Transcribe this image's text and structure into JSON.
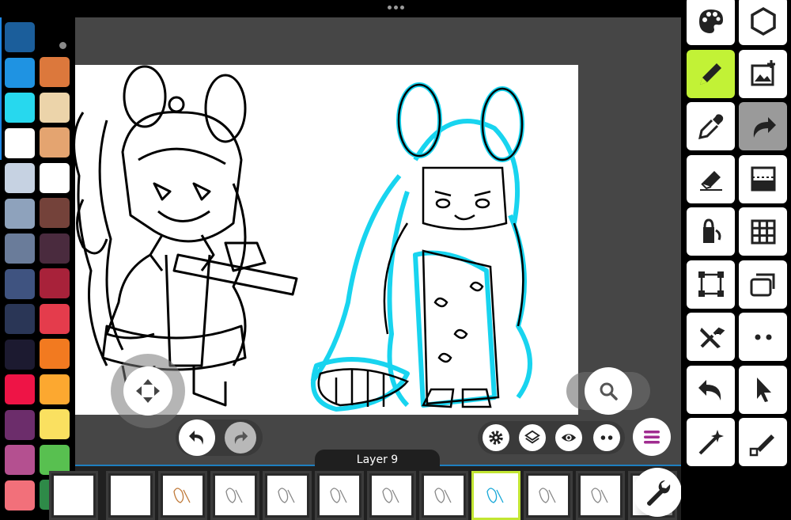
{
  "window": {
    "grabber_icon": "more-horizontal-icon"
  },
  "palette": {
    "colors": [
      "#1b5e9b",
      "#1f93e2",
      "#27d8ee",
      "#ffffff",
      "#c6d2e2",
      "#8ea2bc",
      "#6a7c9a",
      "#3f5380",
      "#2a3656",
      "#1c1a30",
      "#ee1446",
      "#6c2d6b",
      "#b45090",
      "#f2707a",
      "#dc783c",
      "#ecd4aa",
      "#e4a470",
      "#ffffff",
      "#74423a",
      "#4a2b3e",
      "#a8223a",
      "#e43c4c",
      "#f27a20",
      "#fca830",
      "#fae060",
      "#58c050",
      "#2e8a48"
    ]
  },
  "canvas": {
    "zoom_icon": "magnifier-icon",
    "move_icon": "move-arrows-icon"
  },
  "controls": {
    "undo_icon": "undo-icon",
    "redo_icon": "redo-icon",
    "settings_icon": "gear-icon",
    "layers_icon": "layers-icon",
    "visibility_icon": "eye-icon",
    "more_icon": "more-dots-icon",
    "menu_icon": "hamburger-icon",
    "accent": "#a02c90"
  },
  "layers": {
    "current_label": "Layer 9",
    "selected_index": 7,
    "thumb_count": 11,
    "highlight_color": "#c2e532"
  },
  "toolbar": {
    "tools": [
      {
        "name": "palette-icon",
        "active": false
      },
      {
        "name": "hexagon-icon",
        "active": false
      },
      {
        "name": "pencil-icon",
        "active": true
      },
      {
        "name": "add-image-icon",
        "active": false
      },
      {
        "name": "eyedropper-icon",
        "active": false
      },
      {
        "name": "redo-arrow-icon",
        "active": false
      },
      {
        "name": "eraser-icon",
        "active": false
      },
      {
        "name": "gradient-icon",
        "active": false
      },
      {
        "name": "fill-bucket-icon",
        "active": false
      },
      {
        "name": "grid-icon",
        "active": false
      },
      {
        "name": "transform-icon",
        "active": false
      },
      {
        "name": "windows-icon",
        "active": false
      },
      {
        "name": "tools-icon",
        "active": false
      },
      {
        "name": "dots-icon",
        "active": false
      },
      {
        "name": "undo-arrow-icon",
        "active": false
      },
      {
        "name": "pointer-icon",
        "active": false
      },
      {
        "name": "magic-wand-icon",
        "active": false
      },
      {
        "name": "line-pen-icon",
        "active": false
      }
    ],
    "active_color": "#c2f236"
  }
}
